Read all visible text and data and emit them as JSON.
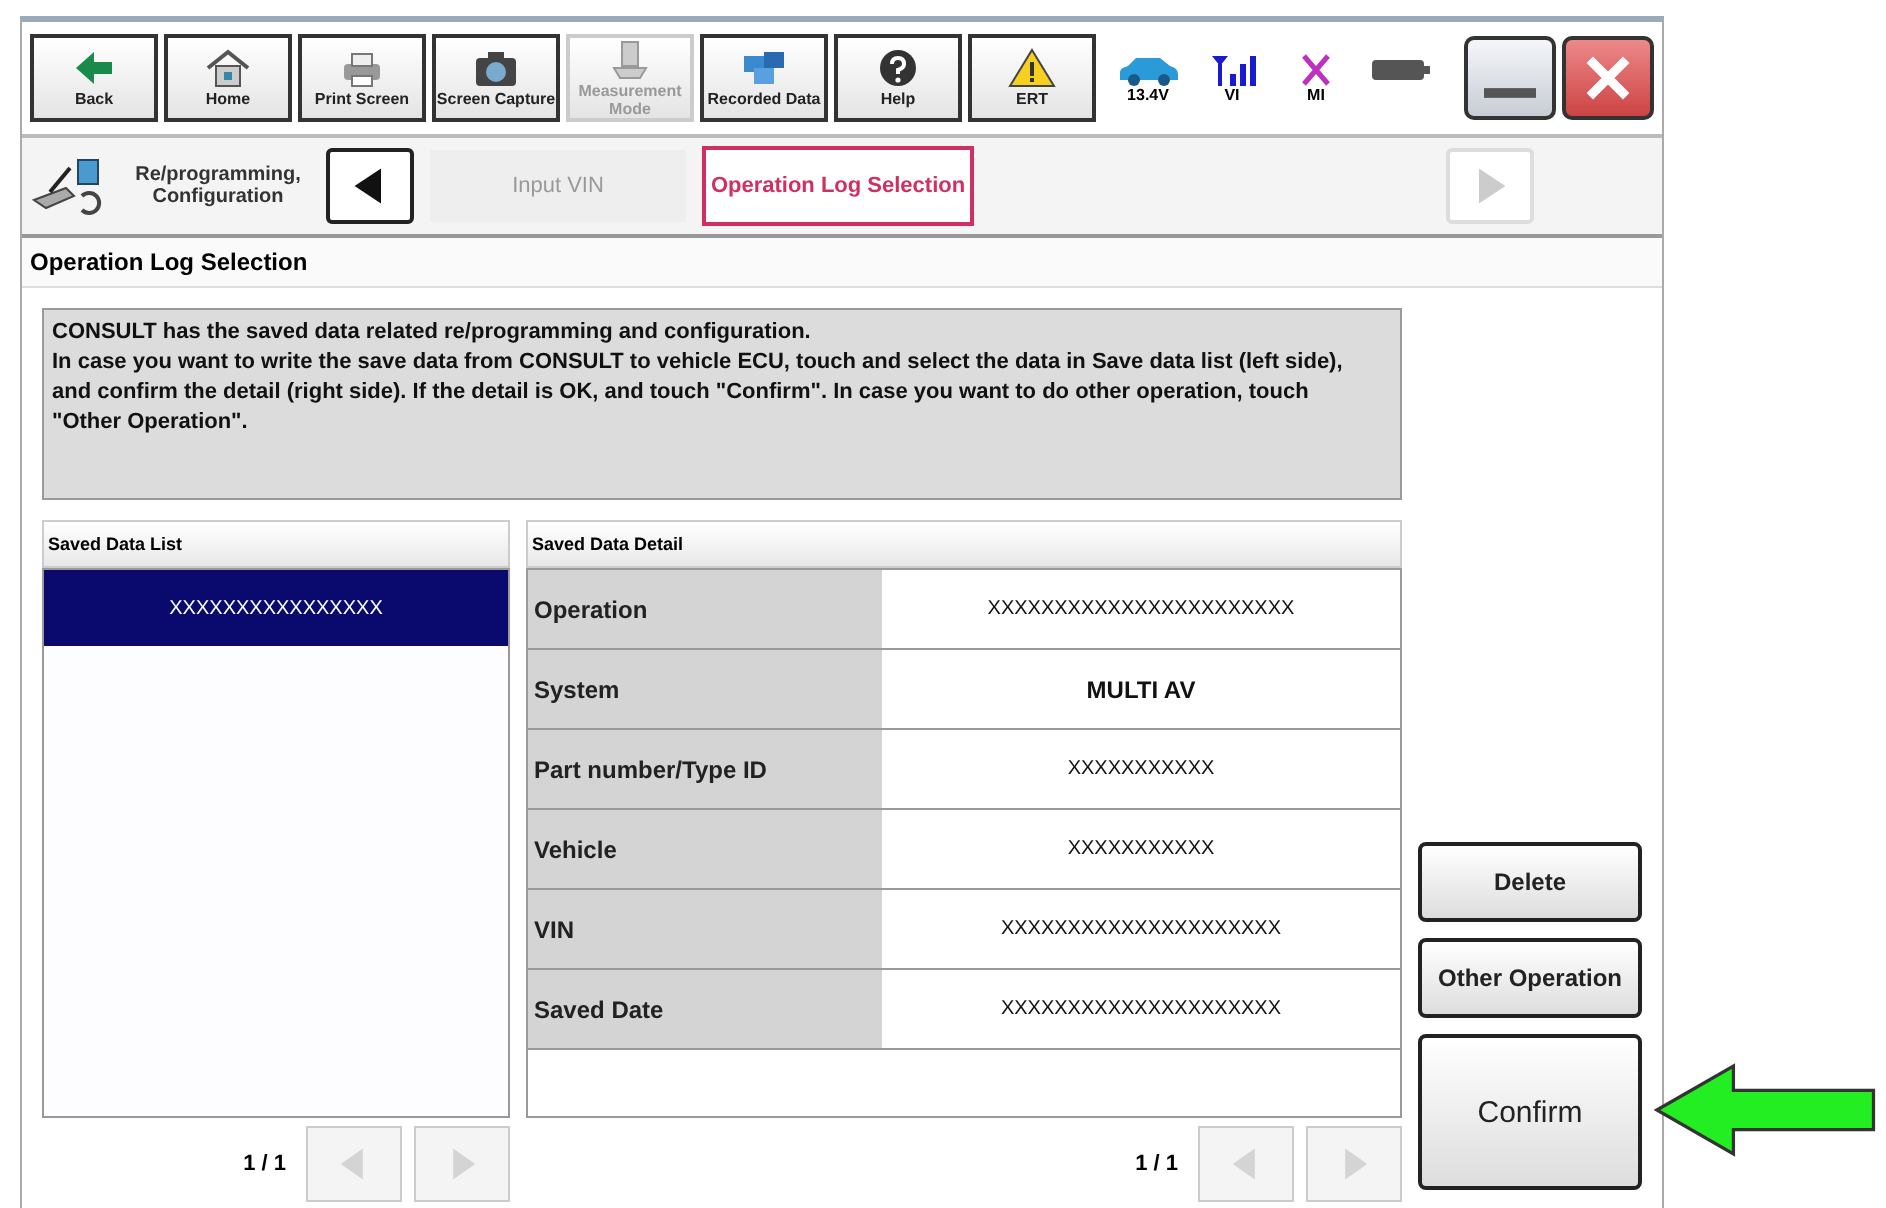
{
  "toolbar": {
    "buttons": [
      {
        "label": "Back",
        "kind": "back",
        "disabled": false
      },
      {
        "label": "Home",
        "kind": "home",
        "disabled": false
      },
      {
        "label": "Print Screen",
        "kind": "print",
        "disabled": false
      },
      {
        "label": "Screen Capture",
        "kind": "camera",
        "disabled": false
      },
      {
        "label": "Measurement Mode",
        "kind": "measure",
        "disabled": true
      },
      {
        "label": "Recorded Data",
        "kind": "data",
        "disabled": false
      },
      {
        "label": "Help",
        "kind": "help",
        "disabled": false
      },
      {
        "label": "ERT",
        "kind": "warning",
        "disabled": false
      }
    ],
    "status": [
      {
        "label": "13.4V",
        "kind": "car"
      },
      {
        "label": "VI",
        "kind": "signal"
      },
      {
        "label": "MI",
        "kind": "cross"
      },
      {
        "kind": "battery"
      }
    ]
  },
  "breadcrumb": {
    "app_label": "Re/programming, Configuration",
    "steps": [
      {
        "label": "Input VIN",
        "selected": false
      },
      {
        "label": "Operation Log Selection",
        "selected": true
      }
    ]
  },
  "screen_title": "Operation Log Selection",
  "message": "CONSULT has the saved data related re/programming and configuration.\nIn case you want to write the save data from CONSULT to vehicle ECU, touch and select the data in Save data list (left side), and confirm the detail (right side). If the detail is OK, and touch \"Confirm\".  In case you want to do other operation, touch \"Other Operation\".",
  "saved_list": {
    "title": "Saved Data List",
    "items": [
      {
        "label": "XXXXXXXXXXXXXXXX",
        "selected": true
      }
    ],
    "page": "1 / 1"
  },
  "detail": {
    "title": "Saved Data Detail",
    "rows": [
      {
        "label": "Operation",
        "value": "XXXXXXXXXXXXXXXXXXXXXXX",
        "bold": false
      },
      {
        "label": "System",
        "value": "MULTI AV",
        "bold": true
      },
      {
        "label": "Part number/Type ID",
        "value": "XXXXXXXXXXX",
        "bold": false
      },
      {
        "label": "Vehicle",
        "value": "XXXXXXXXXXX",
        "bold": false
      },
      {
        "label": "VIN",
        "value": "XXXXXXXXXXXXXXXXXXXXX",
        "bold": false
      },
      {
        "label": "Saved Date",
        "value": "XXXXXXXXXXXXXXXXXXXXX",
        "bold": false
      }
    ],
    "page": "1 / 1"
  },
  "actions": [
    {
      "label": "Delete",
      "kind": "small"
    },
    {
      "label": "Other Operation",
      "kind": "small"
    },
    {
      "label": "Confirm",
      "kind": "large"
    }
  ]
}
